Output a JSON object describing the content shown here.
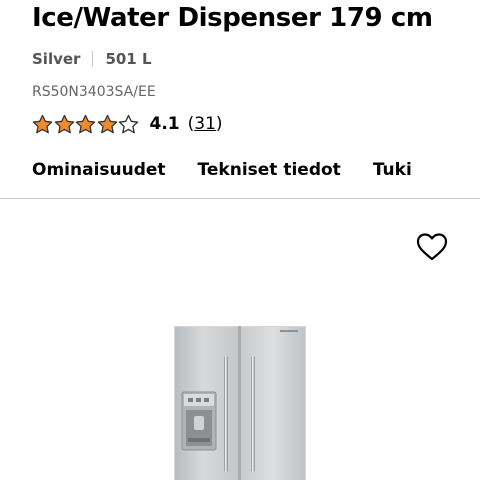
{
  "product": {
    "title": "Ice/Water Dispenser 179 cm",
    "color": "Silver",
    "capacity": "501 L",
    "model": "RS50N3403SA/EE",
    "rating": {
      "value": "4.1",
      "stars_out_of_5": 4.1,
      "open_paren": "(",
      "count": "31",
      "close_paren": ")"
    }
  },
  "tabs": [
    {
      "label": "Ominaisuudet"
    },
    {
      "label": "Tekniset tiedot"
    },
    {
      "label": "Tuki"
    }
  ],
  "icons": {
    "star": "star-icon",
    "wishlist": "heart-outline-icon"
  },
  "colors": {
    "star_fill": "#f08a2c",
    "text": "#000000",
    "muted": "#555555",
    "divider": "#cccccc"
  }
}
